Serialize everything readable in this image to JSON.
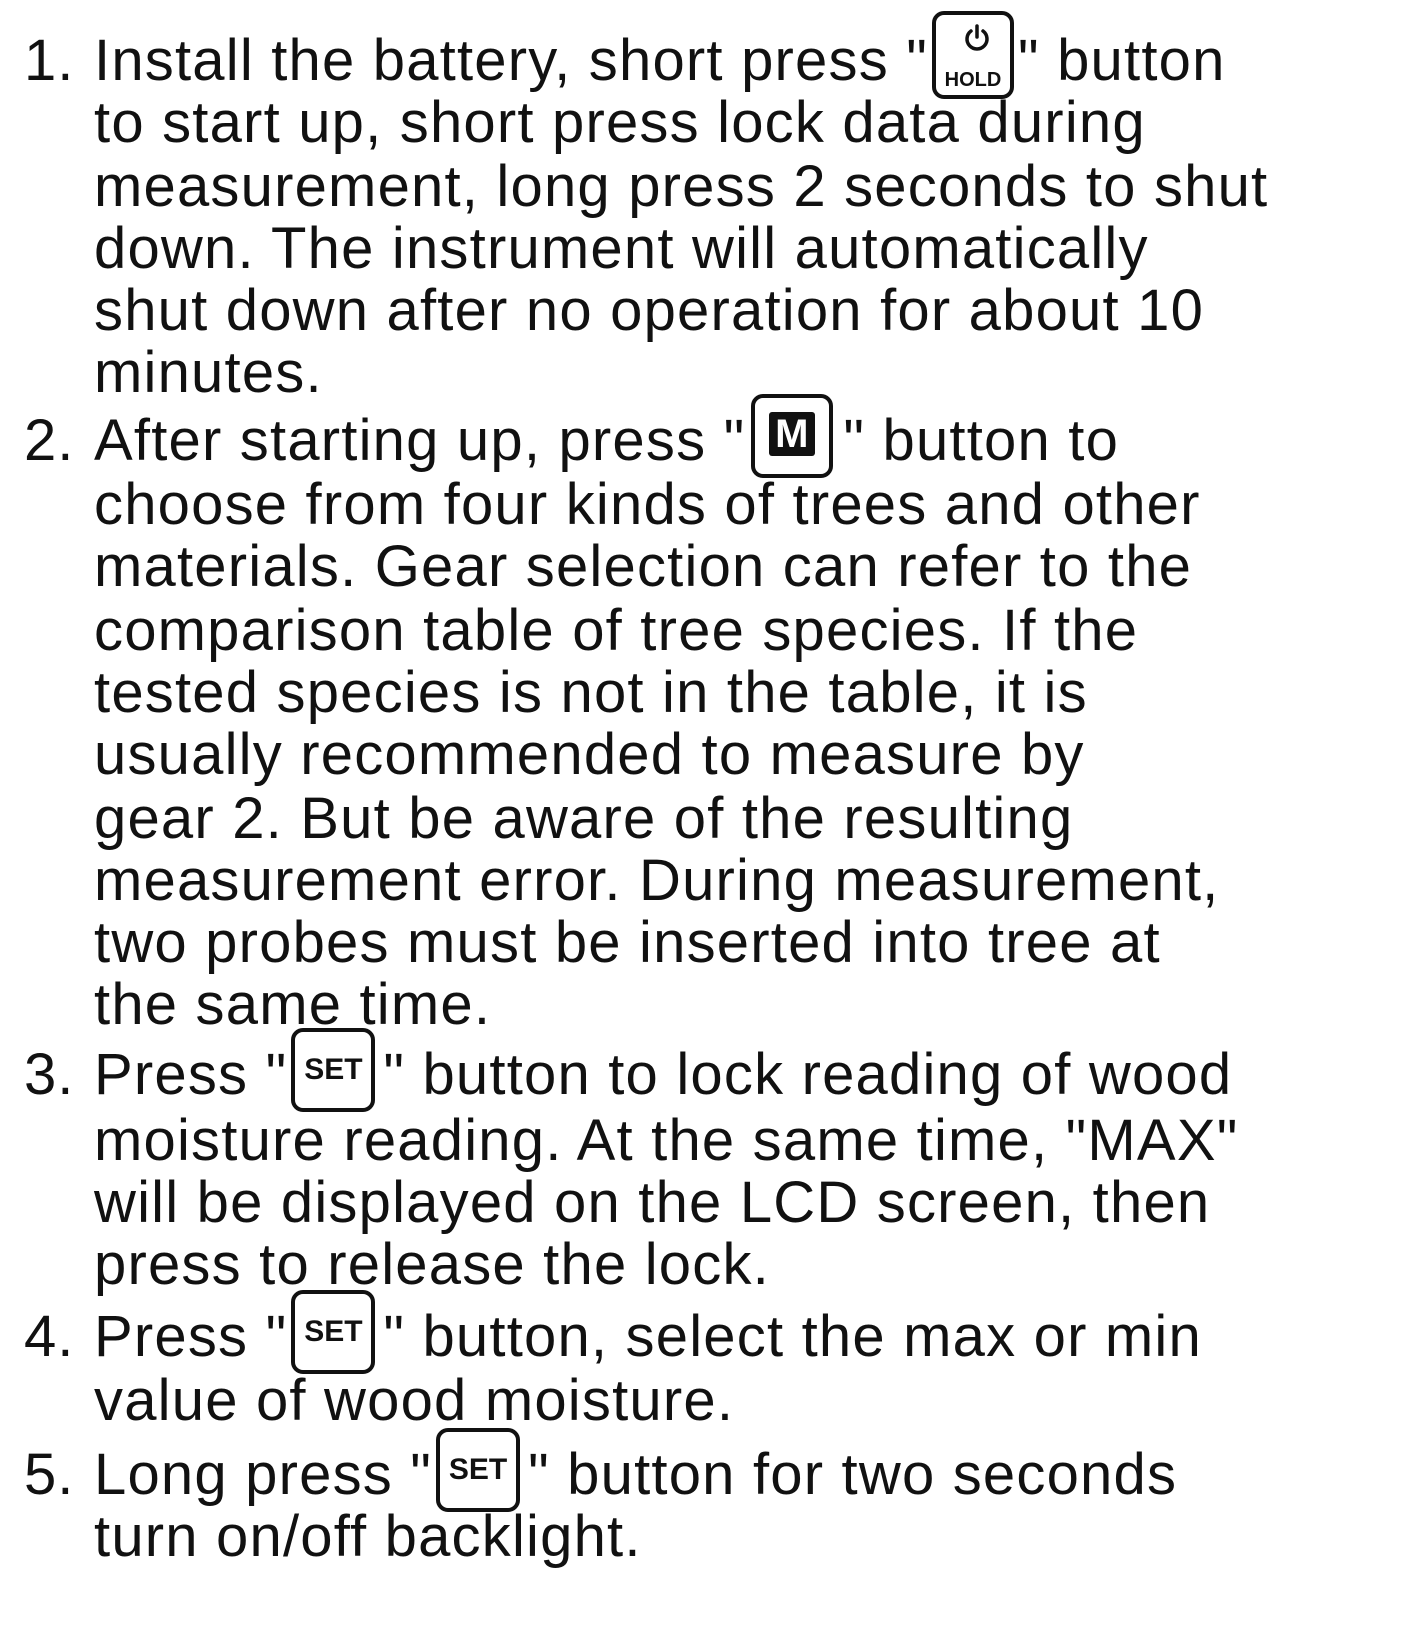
{
  "steps": [
    {
      "number": "1.",
      "lines": [
        {
          "before": "Install the battery, short press \"",
          "icon": "power-hold-icon",
          "after": "\" button"
        },
        {
          "text": "to start up, short press lock data during"
        },
        {
          "text": "measurement, long press 2 seconds to shut"
        },
        {
          "text": "down. The instrument will automatically"
        },
        {
          "text": "shut down after no operation for about 10"
        },
        {
          "text": "minutes."
        }
      ]
    },
    {
      "number": "2.",
      "lines": [
        {
          "before": "After starting up, press \"",
          "icon": "m-button-icon",
          "after": "\" button to"
        },
        {
          "text": "choose from four kinds of trees and other"
        },
        {
          "text": "materials. Gear selection can refer to the"
        },
        {
          "text": "comparison table of tree species. If the"
        },
        {
          "text": "tested species is not in the table, it is"
        },
        {
          "text": "usually recommended to measure by"
        },
        {
          "text": "gear 2. But be aware of the resulting"
        },
        {
          "text": "measurement error. During measurement,"
        },
        {
          "text": "two probes must be inserted into tree at"
        },
        {
          "text": "the same time."
        }
      ]
    },
    {
      "number": "3.",
      "lines": [
        {
          "before": "Press \"",
          "icon": "set-button-icon",
          "after": "\" button to lock reading of wood"
        },
        {
          "text": "moisture reading. At the same time, \"MAX\""
        },
        {
          "text": "will be displayed on the LCD screen, then"
        },
        {
          "text": "press to release the lock."
        }
      ]
    },
    {
      "number": "4.",
      "lines": [
        {
          "before": "Press \"",
          "icon": "set-button-icon",
          "after": "\" button, select the max or min"
        },
        {
          "text": "value of wood moisture."
        }
      ]
    },
    {
      "number": "5.",
      "lines": [
        {
          "before": "Long press \"",
          "icon": "set-button-icon",
          "after": "\" button for two seconds"
        },
        {
          "text": "turn on/off backlight."
        }
      ]
    }
  ],
  "icons": {
    "hold_label": "HOLD",
    "m_label": "M",
    "set_label": "SET"
  }
}
